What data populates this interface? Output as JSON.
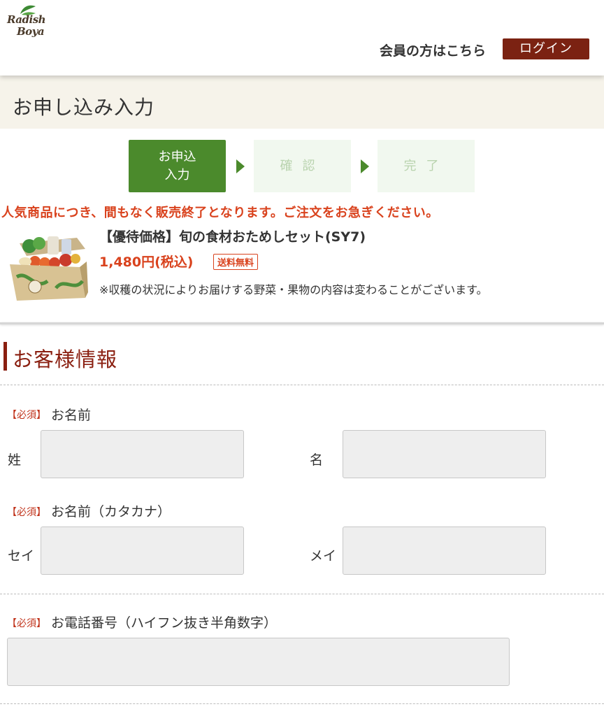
{
  "header": {
    "logo_text_line1": "Radish",
    "logo_text_line2": "Boya",
    "member_text": "会員の方はこちら",
    "login_label": "ログイン"
  },
  "page_title": "お申し込み入力",
  "steps": [
    {
      "label_line1": "お申込",
      "label_line2": "入力",
      "state": "active"
    },
    {
      "label": "確認",
      "state": "inactive"
    },
    {
      "label": "完了",
      "state": "inactive"
    }
  ],
  "notice": "人気商品につき、間もなく販売終了となります。ご注文をお急ぎください。",
  "product": {
    "name": "【優待価格】旬の食材おためしセット(SY7)",
    "price": "1,480円(税込)",
    "badge": "送料無料",
    "note": "※収穫の状況によりお届けする野菜・果物の内容は変わることがございます。"
  },
  "customer": {
    "section_title": "お客様情報",
    "required_label": "【必須】",
    "name": {
      "label": "お名前",
      "last_label": "姓",
      "first_label": "名",
      "last_value": "",
      "first_value": ""
    },
    "kana": {
      "label": "お名前（カタカナ）",
      "last_label": "セイ",
      "first_label": "メイ",
      "last_value": "",
      "first_value": ""
    },
    "phone": {
      "label": "お電話番号（ハイフン抜き半角数字）",
      "value": ""
    }
  },
  "colors": {
    "brand_red": "#7b2212",
    "step_active": "#4b8a2c",
    "notice_red": "#d9421d",
    "title_band": "#f6f3ea"
  }
}
